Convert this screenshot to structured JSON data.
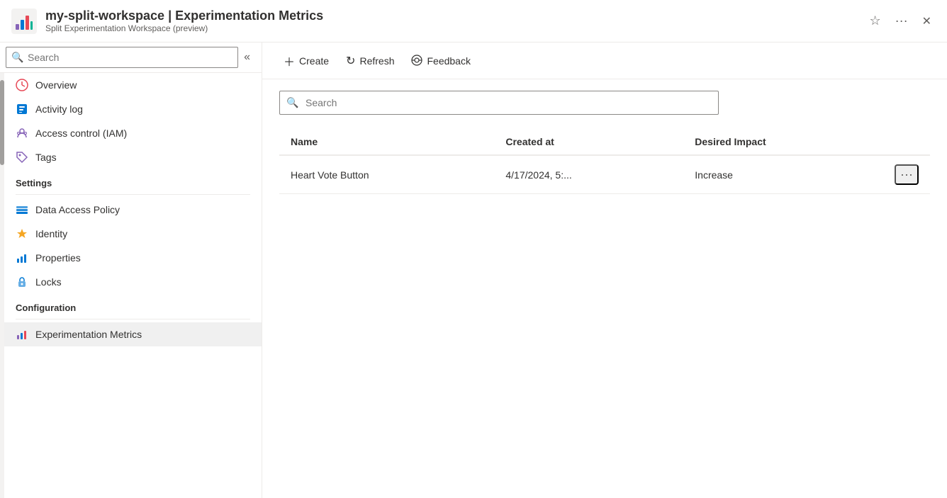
{
  "titleBar": {
    "workspace": "my-split-workspace",
    "separator": "|",
    "page": "Experimentation Metrics",
    "subtitle": "Split Experimentation Workspace (preview)",
    "favoriteTitle": "Add to favorites",
    "moreTitle": "More actions",
    "closeTitle": "Close"
  },
  "sidebar": {
    "searchPlaceholder": "Search",
    "collapseTitle": "Collapse sidebar",
    "items": [
      {
        "id": "overview",
        "label": "Overview",
        "icon": "overview-icon"
      },
      {
        "id": "activity-log",
        "label": "Activity log",
        "icon": "activity-icon"
      },
      {
        "id": "iam",
        "label": "Access control (IAM)",
        "icon": "iam-icon"
      },
      {
        "id": "tags",
        "label": "Tags",
        "icon": "tags-icon"
      }
    ],
    "sections": [
      {
        "header": "Settings",
        "items": [
          {
            "id": "data-access-policy",
            "label": "Data Access Policy",
            "icon": "dap-icon"
          },
          {
            "id": "identity",
            "label": "Identity",
            "icon": "identity-icon"
          },
          {
            "id": "properties",
            "label": "Properties",
            "icon": "properties-icon"
          },
          {
            "id": "locks",
            "label": "Locks",
            "icon": "locks-icon"
          }
        ]
      },
      {
        "header": "Configuration",
        "items": [
          {
            "id": "exp-metrics",
            "label": "Experimentation Metrics",
            "icon": "exp-icon",
            "active": true
          }
        ]
      }
    ]
  },
  "toolbar": {
    "createLabel": "Create",
    "refreshLabel": "Refresh",
    "feedbackLabel": "Feedback"
  },
  "content": {
    "searchPlaceholder": "Search",
    "table": {
      "columns": [
        {
          "id": "name",
          "label": "Name"
        },
        {
          "id": "created-at",
          "label": "Created at"
        },
        {
          "id": "desired-impact",
          "label": "Desired Impact"
        }
      ],
      "rows": [
        {
          "name": "Heart Vote Button",
          "createdAt": "4/17/2024, 5:...",
          "desiredImpact": "Increase"
        }
      ]
    }
  }
}
